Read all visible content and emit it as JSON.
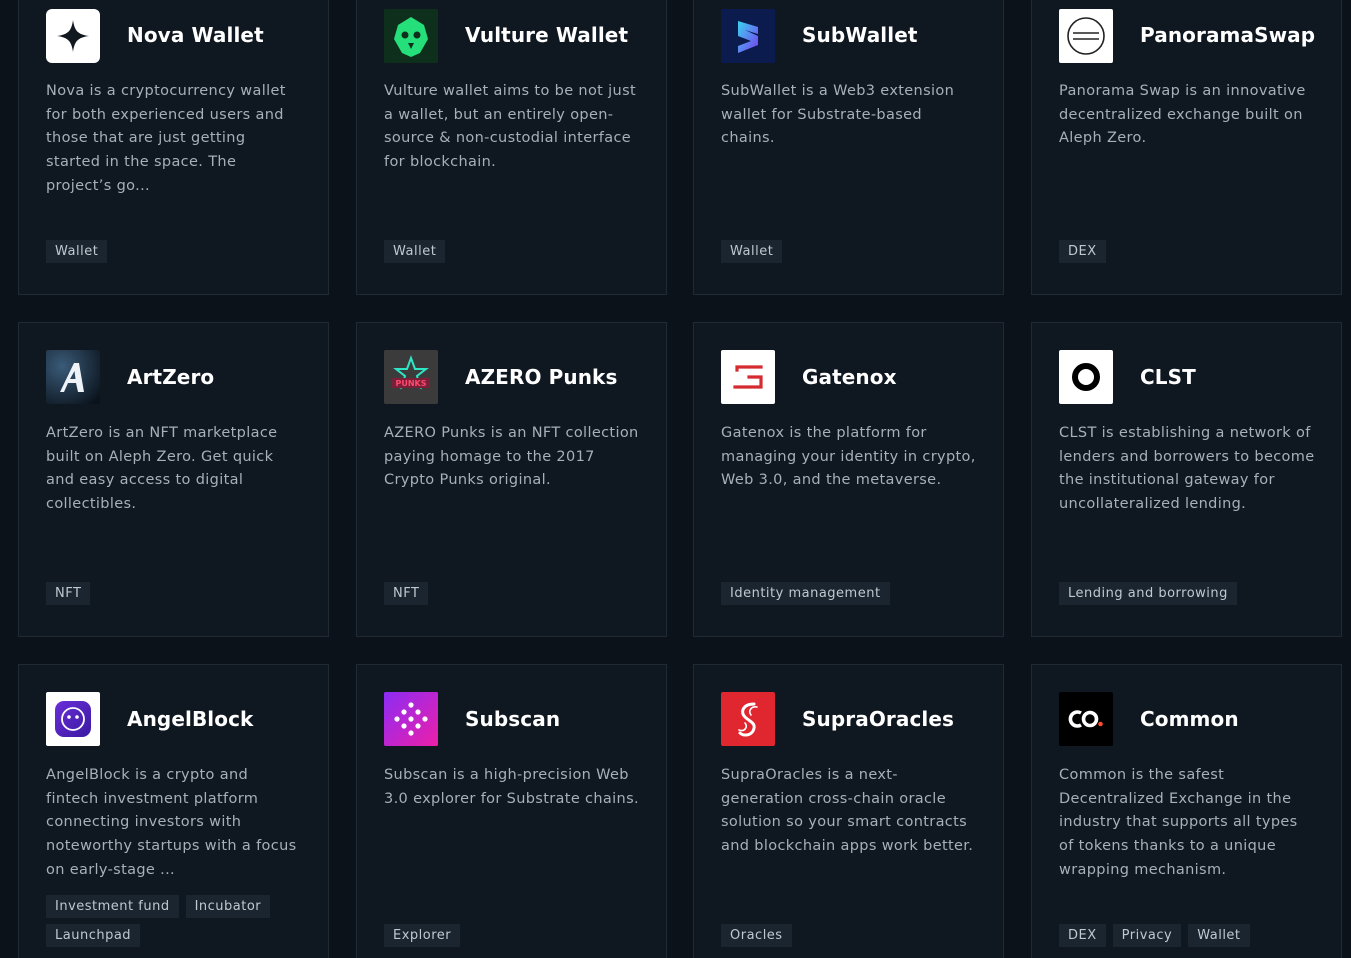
{
  "cards": [
    {
      "name": "Nova Wallet",
      "description": "Nova is a cryptocurrency wallet for both experienced users and those that are just getting started in the space. The project’s go...",
      "tags": [
        "Wallet"
      ],
      "logo_icon": "nova-star-icon",
      "logo_bg": "#ffffff"
    },
    {
      "name": "Vulture Wallet",
      "description": "Vulture wallet aims to be not just a wallet, but an entirely open-source & non-custodial interface for blockchain.",
      "tags": [
        "Wallet"
      ],
      "logo_icon": "vulture-bird-icon",
      "logo_bg": "#0f3a22"
    },
    {
      "name": "SubWallet",
      "description": "SubWallet is a Web3 extension wallet for Substrate-based chains.",
      "tags": [
        "Wallet"
      ],
      "logo_icon": "subwallet-s-icon",
      "logo_bg": "#0b1b4d"
    },
    {
      "name": "PanoramaSwap",
      "description": "Panorama Swap is an innovative decentralized exchange built on Aleph Zero.",
      "tags": [
        "DEX"
      ],
      "logo_icon": "panorama-circle-icon",
      "logo_bg": "#ffffff"
    },
    {
      "name": "ArtZero",
      "description": "ArtZero is an NFT marketplace built on Aleph Zero. Get quick and easy access to digital collectibles.",
      "tags": [
        "NFT"
      ],
      "logo_icon": "artzero-a-icon",
      "logo_bg": "#0e1a26"
    },
    {
      "name": "AZERO Punks",
      "description": "AZERO Punks is an NFT collection paying homage to the 2017 Crypto Punks original.",
      "tags": [
        "NFT"
      ],
      "logo_icon": "punks-star-icon",
      "logo_bg": "#3a3a3a"
    },
    {
      "name": "Gatenox",
      "description": "Gatenox is the platform for managing your identity in crypto, Web 3.0, and the metaverse.",
      "tags": [
        "Identity management"
      ],
      "logo_icon": "gatenox-g-icon",
      "logo_bg": "#ffffff"
    },
    {
      "name": "CLST",
      "description": "CLST is establishing a network of lenders and borrowers to become the institutional gateway for uncollateralized lending.",
      "tags": [
        "Lending and borrowing"
      ],
      "logo_icon": "clst-ring-icon",
      "logo_bg": "#ffffff"
    },
    {
      "name": "AngelBlock",
      "description": "AngelBlock is a crypto and fintech investment platform connecting investors with noteworthy startups with a focus on early-stage ...",
      "tags": [
        "Investment fund",
        "Incubator",
        "Launchpad"
      ],
      "logo_icon": "angelblock-face-icon",
      "logo_bg": "#ffffff"
    },
    {
      "name": "Subscan",
      "description": "Subscan is a high-precision Web 3.0 explorer for Substrate chains.",
      "tags": [
        "Explorer"
      ],
      "logo_icon": "subscan-dots-icon",
      "logo_bg": "#c21fd6"
    },
    {
      "name": "SupraOracles",
      "description": "SupraOracles is a next-generation cross-chain oracle solution so your smart contracts and blockchain apps work better.",
      "tags": [
        "Oracles"
      ],
      "logo_icon": "supra-s-icon",
      "logo_bg": "#e0262f"
    },
    {
      "name": "Common",
      "description": "Common is the safest Decentralized Exchange in the industry that supports all types of tokens thanks to a unique wrapping mechanism.",
      "tags": [
        "DEX",
        "Privacy",
        "Wallet"
      ],
      "logo_icon": "common-co-icon",
      "logo_bg": "#000000"
    }
  ]
}
